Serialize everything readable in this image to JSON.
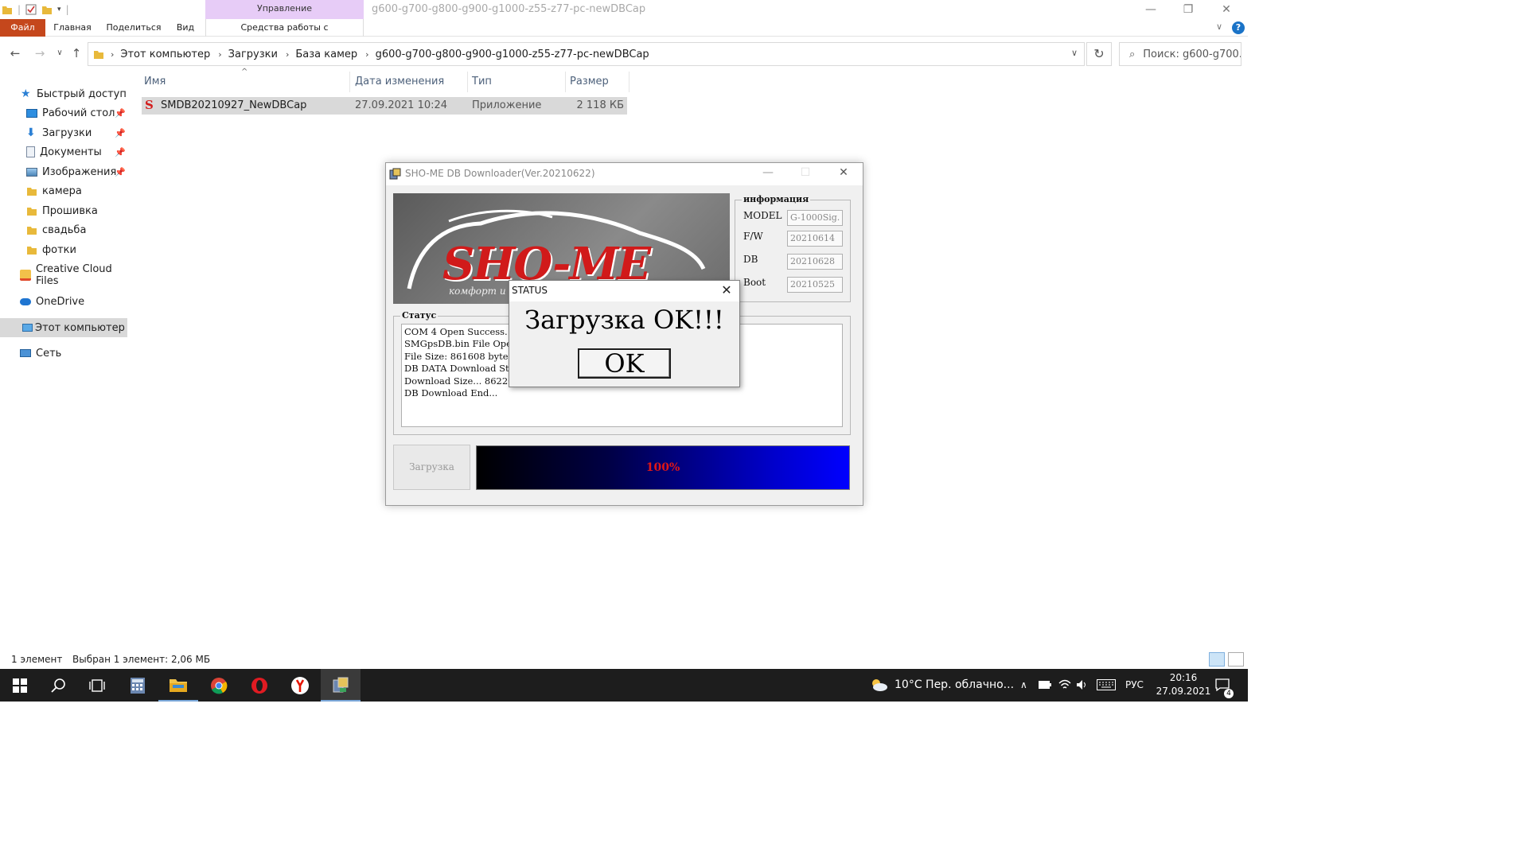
{
  "explorer": {
    "manage_tab": "Управление",
    "window_title": "g600-g700-g800-g900-g1000-z55-z77-pc-newDBCap",
    "ribbon_tabs": {
      "file": "Файл",
      "home": "Главная",
      "share": "Поделиться",
      "view": "Вид",
      "app_tools": "Средства работы с приложениями"
    },
    "breadcrumbs": [
      "Этот компьютер",
      "Загрузки",
      "База камер",
      "g600-g700-g800-g900-g1000-z55-z77-pc-newDBCap"
    ],
    "search_placeholder": "Поиск: g600-g700...",
    "nav": {
      "quick_access": "Быстрый доступ",
      "desktop": "Рабочий стол",
      "downloads": "Загрузки",
      "documents": "Документы",
      "pictures": "Изображения",
      "camera": "камера",
      "firmware": "Прошивка",
      "wedding": "свадьба",
      "photos": "фотки",
      "creative_cloud": "Creative Cloud Files",
      "onedrive": "OneDrive",
      "this_pc": "Этот компьютер",
      "network": "Сеть"
    },
    "columns": {
      "name": "Имя",
      "date": "Дата изменения",
      "type": "Тип",
      "size": "Размер"
    },
    "file": {
      "name": "SMDB20210927_NewDBCap",
      "date": "27.09.2021 10:24",
      "type": "Приложение",
      "size": "2 118 КБ"
    },
    "status": {
      "count": "1 элемент",
      "selected": "Выбран 1 элемент: 2,06 МБ"
    }
  },
  "app": {
    "title": "SHO-ME DB Downloader(Ver.20210622)",
    "banner_logo": "SHO-ME",
    "banner_sub": "комфорт и н",
    "info": {
      "group_title": "информация",
      "model_label": "MODEL",
      "model_value": "G-1000Sig.",
      "fw_label": "F/W",
      "fw_value": "20210614",
      "db_label": "DB",
      "db_value": "20210628",
      "boot_label": "Boot",
      "boot_value": "20210525"
    },
    "status_group_title": "Статус",
    "log": [
      "COM 4 Open Success.",
      "SMGpsDB.bin File Open Success.",
      "File Size: 861608 bytes",
      "DB DATA Download Start...",
      "Download Size... 862208 bytes",
      "DB Download End..."
    ],
    "download_button": "Загрузка",
    "progress_percent": 100,
    "progress_text": "100%"
  },
  "dialog": {
    "title": "STATUS",
    "message": "Загрузка OK!!!",
    "ok_label": "OK"
  },
  "taskbar": {
    "weather": "10°C  Пер. облачно...",
    "language": "РУС",
    "time": "20:16",
    "date": "27.09.2021",
    "notifications": "4"
  },
  "colors": {
    "file_tab": "#c5471c",
    "manage_tab": "#e7ccf7",
    "progress_text": "#e01616",
    "logo_red": "#d11a1a"
  }
}
